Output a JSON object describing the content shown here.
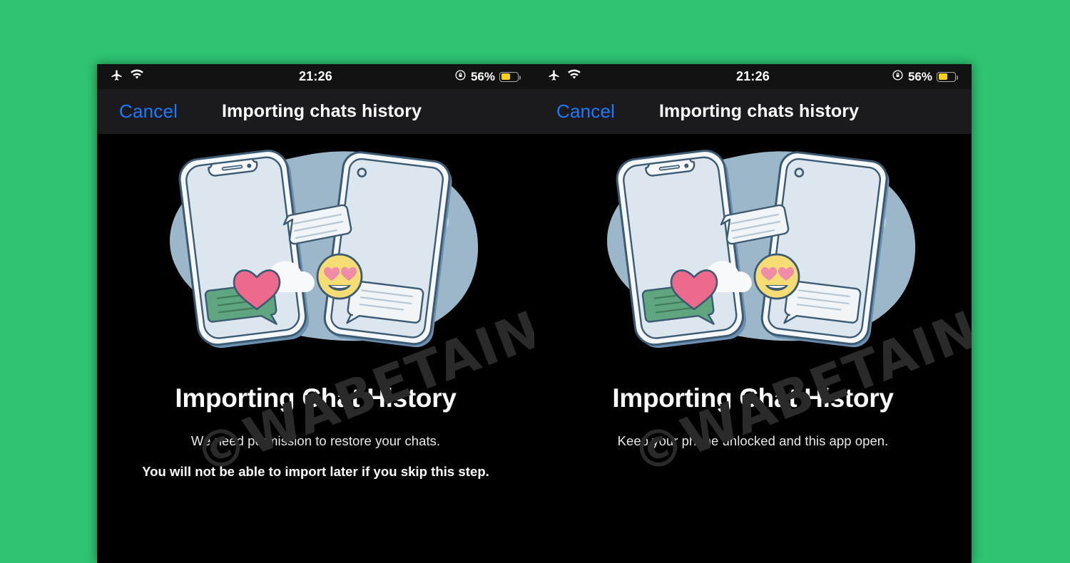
{
  "page": {
    "background_color": "#2ec472",
    "watermark_text": "©WABETAINFO"
  },
  "colors": {
    "accent_green": "#2ec472",
    "ios_blue": "#1d7afc",
    "battery_yellow": "#f7d117",
    "status_bar_bg": "#121212",
    "nav_bar_bg": "#1b1b1d",
    "body_bg": "#000000",
    "blob_blue": "#9cb6ca",
    "phone_screen": "#dce6ef",
    "phone_outline": "#3d5a73",
    "bubble_green": "#5fa57f",
    "heart_pink": "#ed6a8c",
    "emoji_yellow": "#f6dd73",
    "cloud_white": "#f7f9fa",
    "watermark_gray": "#2a2a2a"
  },
  "screens": [
    {
      "id": "permission-screen",
      "status_bar": {
        "airplane_icon": "airplane-mode-icon",
        "wifi_icon": "wifi-icon",
        "time": "21:26",
        "rotation_lock_icon": "rotation-lock-icon",
        "battery_percent": "56%",
        "battery_level": 56,
        "battery_low_power": true
      },
      "nav_bar": {
        "cancel_label": "Cancel",
        "title": "Importing chats history"
      },
      "illustration": {
        "name": "chat-transfer-illustration",
        "elements": [
          "blue-blob",
          "iphone-with-notch",
          "android-phone",
          "green-chat-bubble",
          "white-chat-bubble-top",
          "white-chat-bubble-bottom",
          "pink-heart",
          "heart-eyes-emoji",
          "cloud-large",
          "cloud-small"
        ]
      },
      "content": {
        "title": "Importing Chat History",
        "subtitle": "We need permission to restore your chats.",
        "warning": "You will not be able to import later if you skip this step.",
        "has_warning": true
      }
    },
    {
      "id": "progress-screen",
      "status_bar": {
        "airplane_icon": "airplane-mode-icon",
        "wifi_icon": "wifi-icon",
        "time": "21:26",
        "rotation_lock_icon": "rotation-lock-icon",
        "battery_percent": "56%",
        "battery_level": 56,
        "battery_low_power": true
      },
      "nav_bar": {
        "cancel_label": "Cancel",
        "title": "Importing chats history"
      },
      "illustration": {
        "name": "chat-transfer-illustration",
        "elements": [
          "blue-blob",
          "iphone-with-notch",
          "android-phone",
          "green-chat-bubble",
          "white-chat-bubble-top",
          "white-chat-bubble-bottom",
          "pink-heart",
          "heart-eyes-emoji",
          "cloud-large",
          "cloud-small"
        ]
      },
      "content": {
        "title": "Importing Chat History",
        "subtitle": "Keep your phone unlocked and this app open.",
        "warning": "",
        "has_warning": false
      }
    }
  ]
}
